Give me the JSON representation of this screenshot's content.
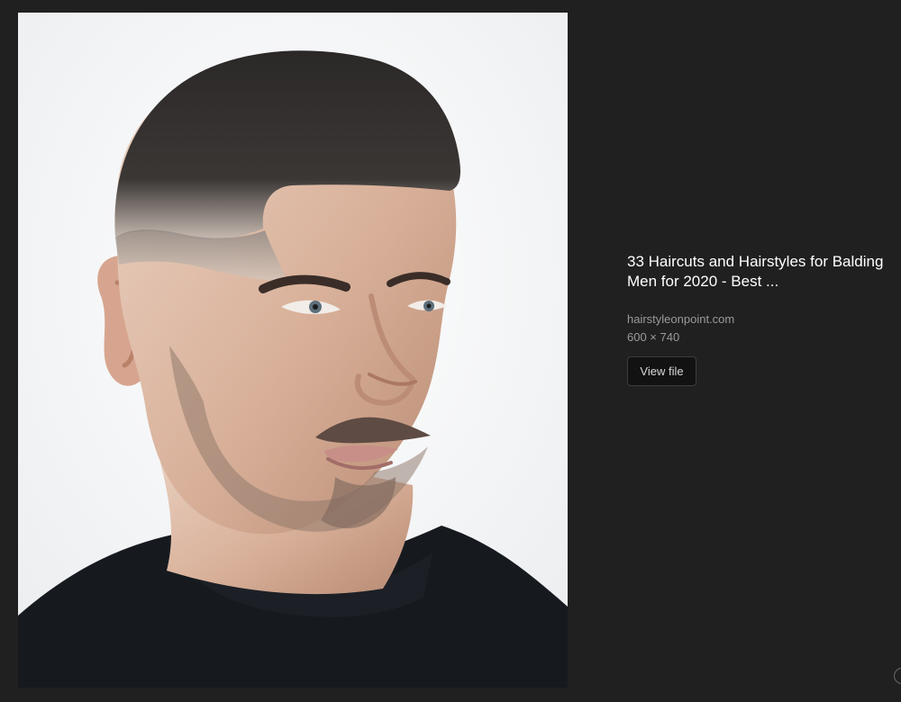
{
  "preview": {
    "alt": "Man with short buzz haircut and beard, wearing black t-shirt"
  },
  "result": {
    "title": "33 Haircuts and Hairstyles for Balding Men for 2020 - Best ...",
    "source": "hairstyleonpoint.com",
    "dimensions": "600 × 740",
    "view_file_label": "View file"
  },
  "colors": {
    "background": "#202020",
    "title": "#ffffff",
    "meta": "#9a9a9a",
    "button": "#121212"
  }
}
